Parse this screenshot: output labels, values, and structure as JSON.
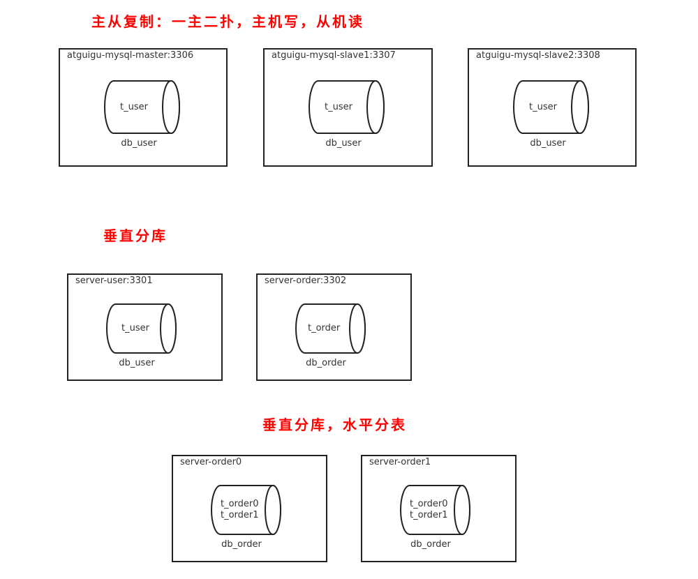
{
  "sections": [
    {
      "title": "主从复制：一主二扑，主机写，从机读",
      "servers": [
        {
          "name": "atguigu-mysql-master:3306",
          "tables": [
            "t_user"
          ],
          "database": "db_user"
        },
        {
          "name": "atguigu-mysql-slave1:3307",
          "tables": [
            "t_user"
          ],
          "database": "db_user"
        },
        {
          "name": "atguigu-mysql-slave2:3308",
          "tables": [
            "t_user"
          ],
          "database": "db_user"
        }
      ]
    },
    {
      "title": "垂直分库",
      "servers": [
        {
          "name": "server-user:3301",
          "tables": [
            "t_user"
          ],
          "database": "db_user"
        },
        {
          "name": "server-order:3302",
          "tables": [
            "t_order"
          ],
          "database": "db_order"
        }
      ]
    },
    {
      "title": "垂直分库，水平分表",
      "servers": [
        {
          "name": "server-order0",
          "tables": [
            "t_order0",
            "t_order1"
          ],
          "database": "db_order"
        },
        {
          "name": "server-order1",
          "tables": [
            "t_order0",
            "t_order1"
          ],
          "database": "db_order"
        }
      ]
    }
  ],
  "colors": {
    "title": "#ff0000",
    "stroke": "#222222",
    "text": "#333333"
  }
}
